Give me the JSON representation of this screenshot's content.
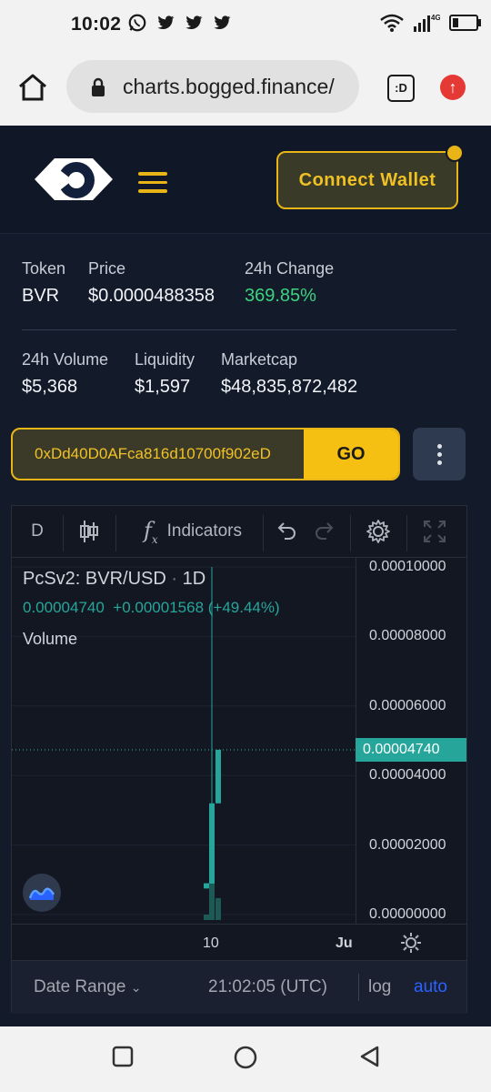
{
  "status_bar": {
    "time": "10:02",
    "notifications": [
      "whatsapp-icon",
      "twitter-icon",
      "twitter-icon",
      "twitter-icon"
    ],
    "network": "4G"
  },
  "browser": {
    "url": "charts.bogged.finance/",
    "tab_label": ":D"
  },
  "header": {
    "connect_label": "Connect Wallet",
    "accent": "#e9b516"
  },
  "token_info": {
    "token_label": "Token",
    "token": "BVR",
    "price_label": "Price",
    "price": "$0.0000488358",
    "change_label": "24h Change",
    "change": "369.85%",
    "volume_label": "24h Volume",
    "volume": "$5,368",
    "liquidity_label": "Liquidity",
    "liquidity": "$1,597",
    "marketcap_label": "Marketcap",
    "marketcap": "$48,835,872,482"
  },
  "address_bar": {
    "value": "0xDd40D0AFca816d10700f902eD",
    "go_label": "GO"
  },
  "chart_toolbar": {
    "interval": "D",
    "indicators_label": "Indicators"
  },
  "chart_data": {
    "type": "candlestick",
    "symbol": "PcSv2: BVR/USD",
    "interval": "1D",
    "last_value": "0.00004740",
    "change": "+0.00001568 (+49.44%)",
    "volume_label": "Volume",
    "y_ticks": [
      "0.00010000",
      "0.00008000",
      "0.00006000",
      "0.00004000",
      "0.00002000",
      "0.00000000"
    ],
    "ylim": [
      0,
      0.0001
    ],
    "price_tag": "0.00004740",
    "x_ticks": [
      "10",
      "Ju"
    ],
    "candles": [
      {
        "open": 9e-06,
        "high": 9e-06,
        "low": 7.5e-06,
        "close": 7.5e-06,
        "color": "#26a69a"
      },
      {
        "open": 3e-06,
        "high": 0.0001,
        "low": 0.0,
        "close": 3.2e-05,
        "color": "#26a69a"
      },
      {
        "open": 3.2e-05,
        "high": 4.74e-05,
        "low": 3.2e-05,
        "close": 4.74e-05,
        "color": "#26a69a"
      }
    ],
    "volumes": [
      0.15,
      1.0,
      0.6
    ],
    "up_color": "#26a69a"
  },
  "chart_bottom": {
    "date_range_label": "Date Range",
    "time": "21:02:05 (UTC)",
    "log_label": "log",
    "auto_label": "auto"
  }
}
